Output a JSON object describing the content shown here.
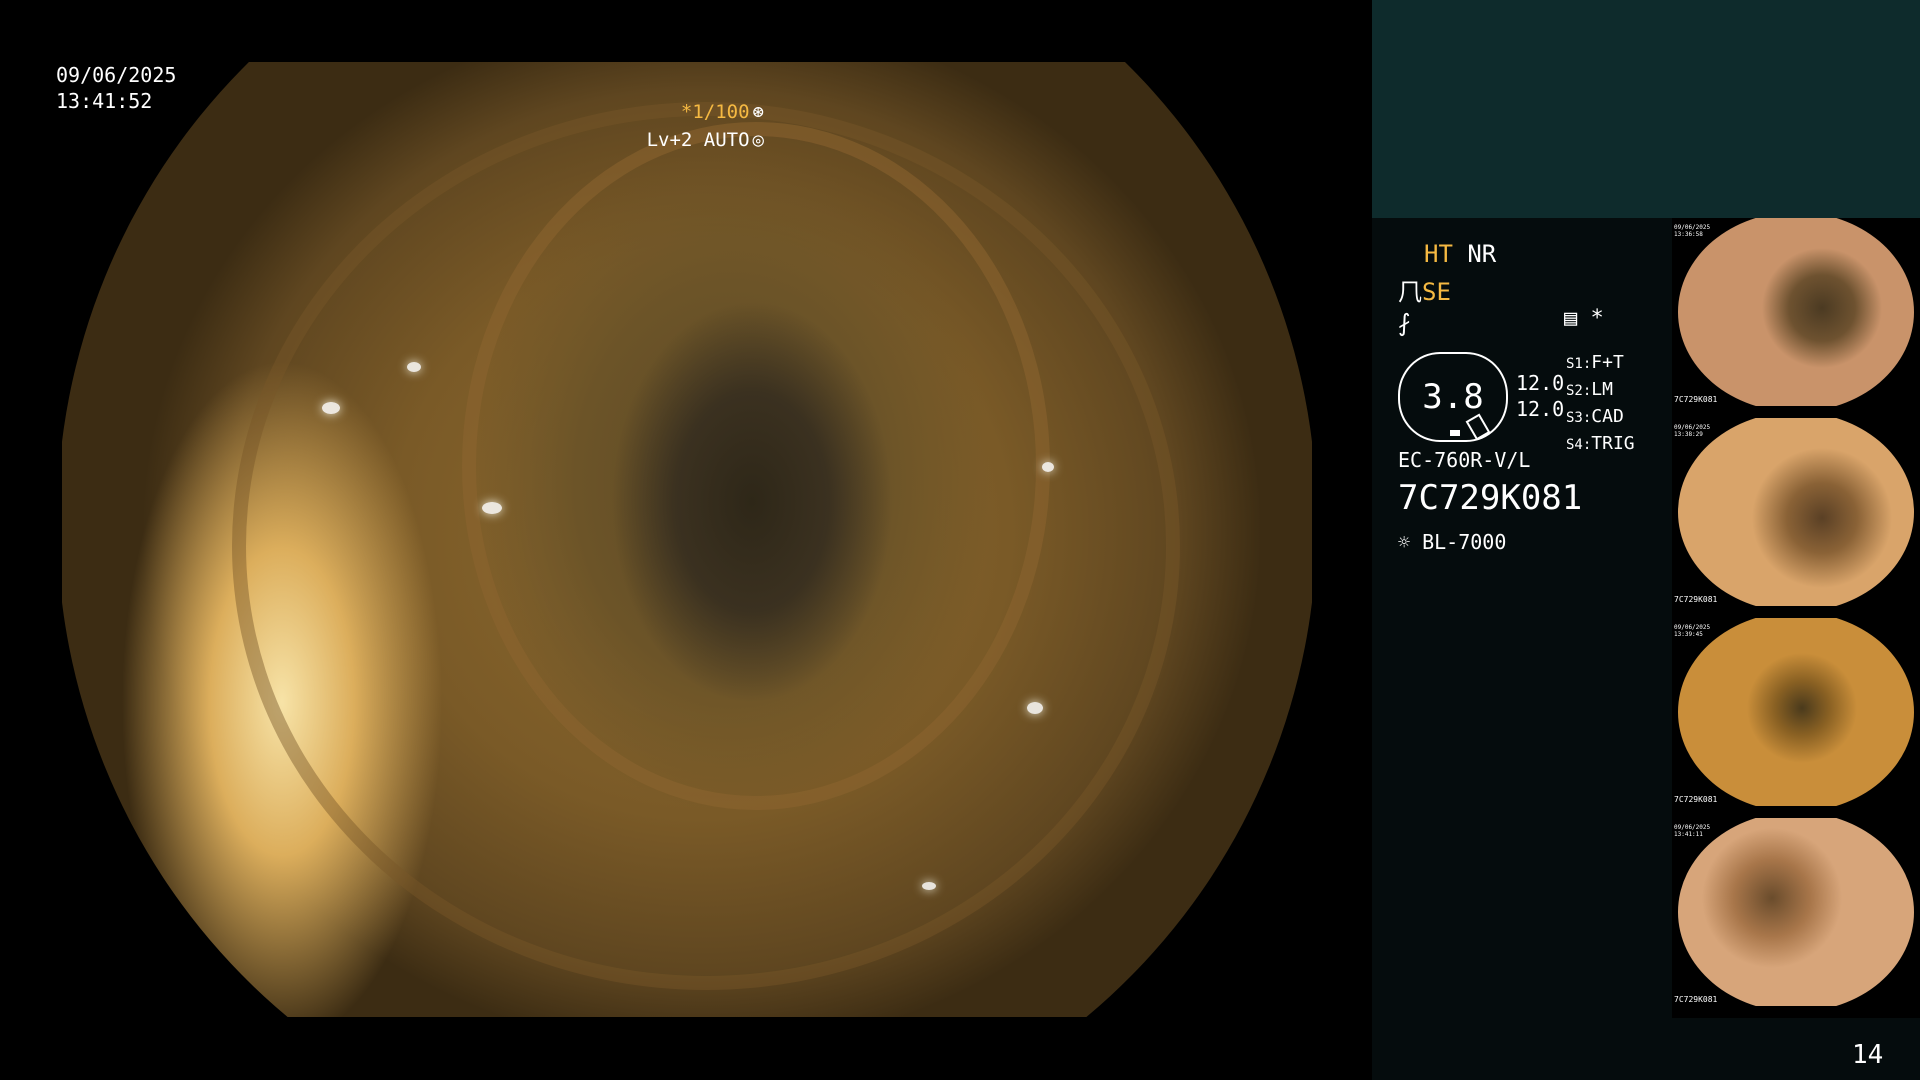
{
  "osd": {
    "date": "09/06/2025",
    "time": "13:41:52",
    "shutter": "*1/100",
    "shutter_icon": "aperture-icon",
    "level": "Lv+2 AUTO",
    "level_icon": "auto-iris-icon"
  },
  "panel": {
    "mode1_a": "HT",
    "mode1_b": "NR",
    "mode2": "SE",
    "gauge_value": "3.8",
    "gain_1": "12.0",
    "gain_2": "12.0",
    "presets": [
      {
        "key": "S1:",
        "value": "F+T"
      },
      {
        "key": "S2:",
        "value": "LM"
      },
      {
        "key": "S3:",
        "value": "CAD"
      },
      {
        "key": "S4:",
        "value": "TRIG"
      }
    ],
    "scope_model": "EC-760R-V/L",
    "scope_serial": "7C729K081",
    "light_source": "BL-7000",
    "star": "*"
  },
  "thumbnails": [
    {
      "date": "09/06/2025",
      "time": "13:36:58",
      "serial": "7C729K081"
    },
    {
      "date": "09/06/2025",
      "time": "13:38:29",
      "serial": "7C729K081"
    },
    {
      "date": "09/06/2025",
      "time": "13:39:45",
      "serial": "7C729K081"
    },
    {
      "date": "09/06/2025",
      "time": "13:41:11",
      "serial": "7C729K081"
    }
  ],
  "page_number": "14",
  "colors": {
    "accent": "#f5b942",
    "panel_top": "#0e2b2c",
    "panel_bottom": "#050c0d"
  }
}
